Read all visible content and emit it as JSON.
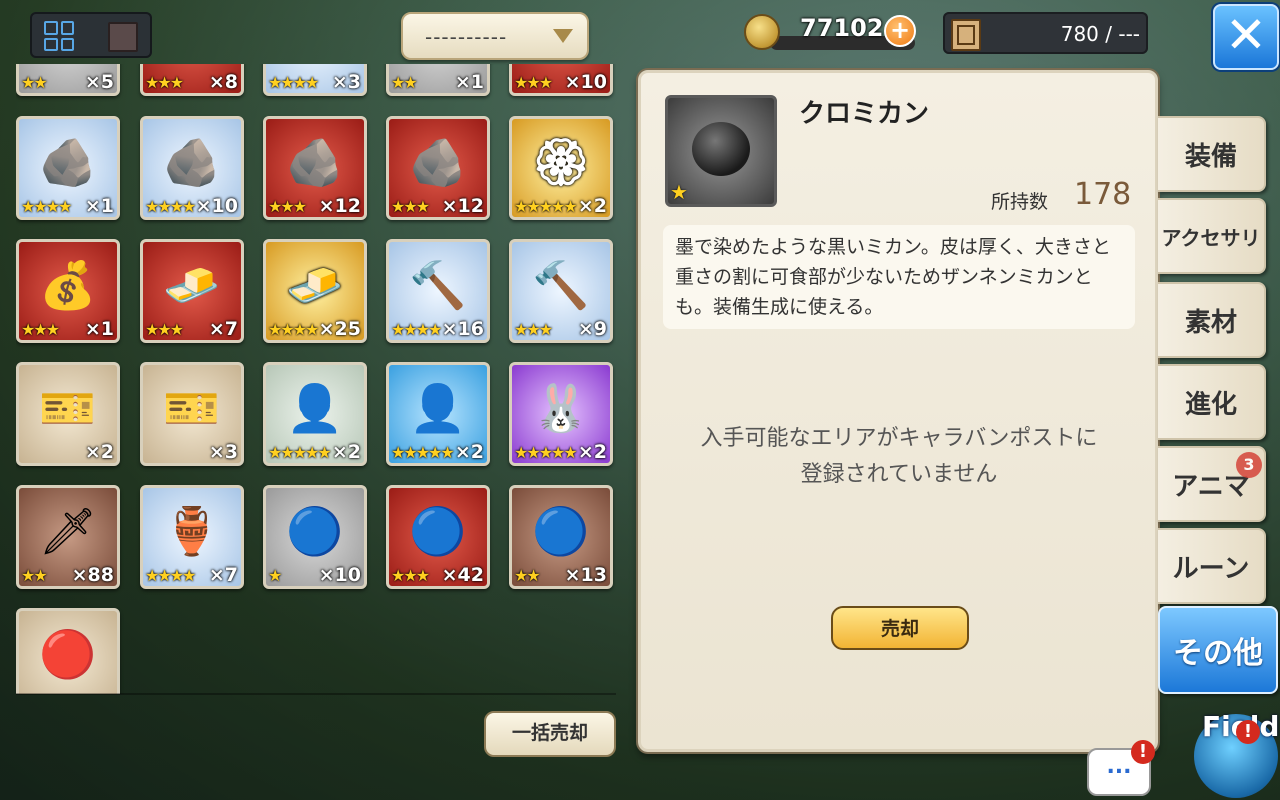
{
  "header": {
    "view_toggle": [
      "grid-view-icon",
      "single-view-icon"
    ],
    "filter_value": "----------",
    "gold": "77102",
    "gold_plus": "+",
    "capacity": "780 / ---",
    "close": "✕"
  },
  "inventory": {
    "top_row_partial": [
      {
        "stars": "★★",
        "count": "×5",
        "color": "gray"
      },
      {
        "stars": "★★★",
        "count": "×8",
        "color": "red"
      },
      {
        "stars": "★★★★",
        "count": "×3",
        "color": "blue"
      },
      {
        "stars": "★★",
        "count": "×1",
        "color": "gray"
      },
      {
        "stars": "★★★",
        "count": "×10",
        "color": "red"
      }
    ],
    "items": [
      {
        "name": "blue-rune-stone",
        "glyph": "🪨",
        "stars": "★★★★",
        "count": "×1",
        "color": "blue"
      },
      {
        "name": "blue-rune-stone",
        "glyph": "🪨",
        "stars": "★★★★",
        "count": "×10",
        "color": "blue"
      },
      {
        "name": "boot-rune-stone",
        "glyph": "🪨",
        "stars": "★★★",
        "count": "×12",
        "color": "red"
      },
      {
        "name": "rune-stone",
        "glyph": "🪨",
        "stars": "★★★",
        "count": "×12",
        "color": "red"
      },
      {
        "name": "golden-orb",
        "glyph": "🏵",
        "stars": "★★★★★",
        "count": "×2",
        "color": "gold"
      },
      {
        "name": "coin-bag",
        "glyph": "💰",
        "stars": "★★★",
        "count": "×1",
        "color": "red"
      },
      {
        "name": "gold-bar",
        "glyph": "🧈",
        "stars": "★★★",
        "count": "×7",
        "color": "red"
      },
      {
        "name": "gold-bars",
        "glyph": "🧈",
        "stars": "★★★★",
        "count": "×25",
        "color": "gold"
      },
      {
        "name": "red-hammer",
        "glyph": "🔨",
        "stars": "★★★★",
        "count": "×16",
        "color": "blue"
      },
      {
        "name": "blue-hammer",
        "glyph": "🔨",
        "stars": "★★★",
        "count": "×9",
        "color": "blue"
      },
      {
        "name": "gold-ticket",
        "glyph": "🎫",
        "stars": "",
        "count": "×2",
        "color": "tan"
      },
      {
        "name": "purple-ticket",
        "glyph": "🎫",
        "stars": "",
        "count": "×3",
        "color": "tan"
      },
      {
        "name": "silhouette-green",
        "glyph": "👤",
        "stars": "★★★★★",
        "count": "×2",
        "color": "green"
      },
      {
        "name": "silhouette-blue",
        "glyph": "👤",
        "stars": "★★★★★",
        "count": "×2",
        "color": "sky"
      },
      {
        "name": "silhouette-purple",
        "glyph": "🐰",
        "stars": "★★★★★",
        "count": "×2",
        "color": "purple"
      },
      {
        "name": "green-spear",
        "glyph": "🗡",
        "stars": "★★",
        "count": "×88",
        "color": "brown"
      },
      {
        "name": "crystal-vase",
        "glyph": "🏺",
        "stars": "★★★★",
        "count": "×7",
        "color": "blue"
      },
      {
        "name": "blue-gem",
        "glyph": "🔵",
        "stars": "★",
        "count": "×10",
        "color": "gray"
      },
      {
        "name": "blue-gem-ring",
        "glyph": "🔵",
        "stars": "★★★",
        "count": "×42",
        "color": "red"
      },
      {
        "name": "blue-gem-brown",
        "glyph": "🔵",
        "stars": "★★",
        "count": "×13",
        "color": "brown"
      },
      {
        "name": "red-orb",
        "glyph": "🔴",
        "stars": "",
        "count": "",
        "color": "tan"
      }
    ],
    "bulk_sell": "一括売却"
  },
  "detail": {
    "name": "クロミカン",
    "owned_label": "所持数",
    "owned_value": "178",
    "rarity": "★",
    "description": "墨で染めたような黒いミカン。皮は厚く、大きさと重さの割に可食部が少ないためザンネンミカンとも。装備生成に使える。",
    "source_line1": "入手可能なエリアがキャラバンポストに",
    "source_line2": "登録されていません",
    "sell": "売却"
  },
  "tabs": [
    {
      "label": "装備",
      "active": false
    },
    {
      "label": "アクセサリ",
      "active": false
    },
    {
      "label": "素材",
      "active": false
    },
    {
      "label": "進化",
      "active": false
    },
    {
      "label": "アニマ",
      "active": false,
      "badge": "3"
    },
    {
      "label": "ルーン",
      "active": false
    },
    {
      "label": "その他",
      "active": true
    }
  ],
  "corner": {
    "field_label": "Field",
    "alert": "!",
    "chat": "...",
    "chat_alert": "!"
  }
}
